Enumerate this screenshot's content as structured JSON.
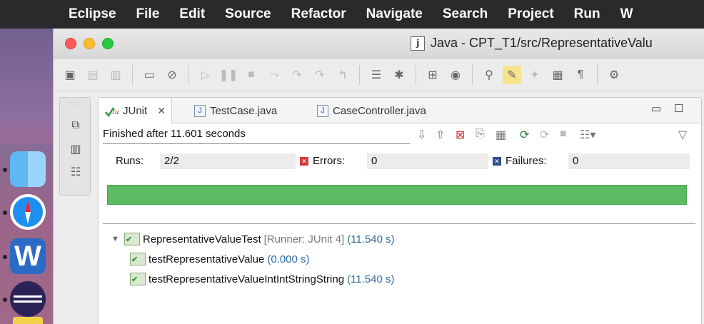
{
  "menubar": {
    "items": [
      "Eclipse",
      "File",
      "Edit",
      "Source",
      "Refactor",
      "Navigate",
      "Search",
      "Project",
      "Run",
      "W"
    ]
  },
  "window": {
    "title": "Java - CPT_T1/src/RepresentativeValu",
    "title_icon": "j"
  },
  "tabs": [
    {
      "label": "JUnit",
      "icon": "junit-icon",
      "active": true
    },
    {
      "label": "TestCase.java",
      "icon": "java-file-icon",
      "active": false
    },
    {
      "label": "CaseController.java",
      "icon": "java-file-icon",
      "active": false
    }
  ],
  "junit": {
    "finished": "Finished after 11.601 seconds",
    "runs_label": "Runs:",
    "runs_value": "2/2",
    "errors_label": "Errors:",
    "errors_value": "0",
    "failures_label": "Failures:",
    "failures_value": "0",
    "progress": 1.0,
    "progress_color": "#5dbb63"
  },
  "tree": {
    "root": {
      "name": "RepresentativeValueTest",
      "runner": "[Runner: JUnit 4]",
      "time": "(11.540 s)"
    },
    "children": [
      {
        "name": "testRepresentativeValue",
        "time": "(0.000 s)"
      },
      {
        "name": "testRepresentativeValueIntIntStringString",
        "time": "(11.540 s)"
      }
    ]
  }
}
